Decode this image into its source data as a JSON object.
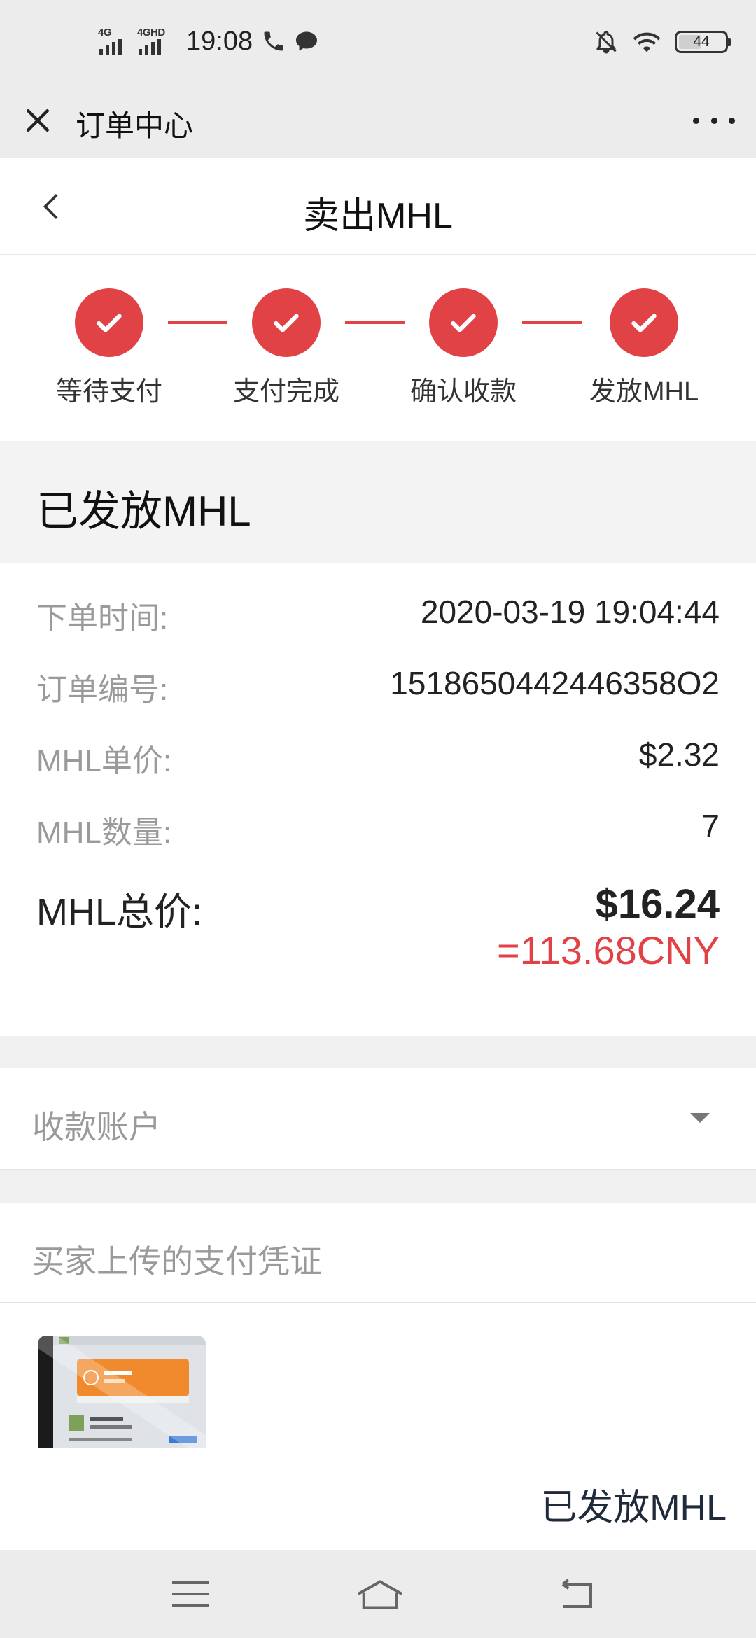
{
  "status_bar": {
    "network1": "4G",
    "network2": "4GHD",
    "time": "19:08",
    "battery": "44"
  },
  "app_bar": {
    "title": "订单中心"
  },
  "page": {
    "title": "卖出MHL"
  },
  "steps": [
    {
      "label": "等待支付",
      "done": true
    },
    {
      "label": "支付完成",
      "done": true
    },
    {
      "label": "确认收款",
      "done": true
    },
    {
      "label": "发放MHL",
      "done": true
    }
  ],
  "status_heading": "已发放MHL",
  "order": {
    "time_label": "下单时间:",
    "time_value": "2020-03-19 19:04:44",
    "id_label": "订单编号:",
    "id_value": "1518650442446358O2",
    "price_label": "MHL单价:",
    "price_value": "$2.32",
    "qty_label": "MHL数量:",
    "qty_value": "7",
    "total_label": "MHL总价:",
    "total_value": "$16.24",
    "total_cny": "=113.68CNY"
  },
  "payee_account": {
    "label": "收款账户"
  },
  "payment_proof": {
    "label": "买家上传的支付凭证"
  },
  "action": {
    "label": "已发放MHL"
  },
  "colors": {
    "accent": "#e04246",
    "action_text": "#1f2a3a"
  }
}
